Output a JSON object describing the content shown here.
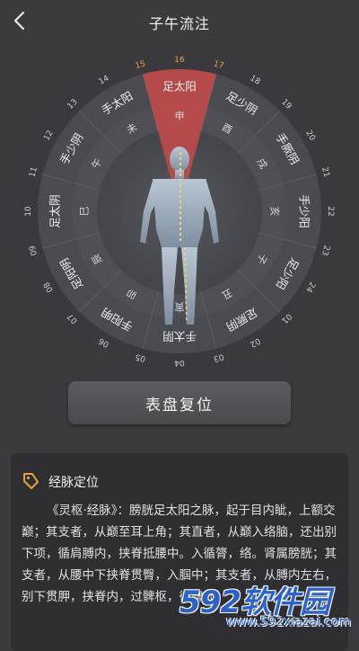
{
  "header": {
    "title": "子午流注"
  },
  "dial": {
    "hours": [
      "15",
      "16",
      "17",
      "18",
      "19",
      "20",
      "21",
      "22",
      "23",
      "24",
      "01",
      "02",
      "03",
      "04",
      "05",
      "06",
      "07",
      "08",
      "09",
      "10",
      "11",
      "12",
      "13",
      "14"
    ],
    "highlight_hour": "16",
    "meridians": [
      "足太阳",
      "足少阴",
      "手厥阴",
      "手少阳",
      "足少阳",
      "足厥阴",
      "手太阴",
      "手阳明",
      "足阳明",
      "足太阴",
      "手少阴",
      "手太阳"
    ],
    "branches": [
      "申",
      "酉",
      "戌",
      "亥",
      "子",
      "丑",
      "寅",
      "卯",
      "辰",
      "巳",
      "午",
      "未"
    ],
    "accent_color": "#c84a4a",
    "hour_color_active": "#e8a23a"
  },
  "reset_button": {
    "label": "表盘复位"
  },
  "panel": {
    "title": "经脉定位",
    "text": "《灵枢·经脉》：膀胱足太阳之脉，起于目内眦，上额交巅；其支者，从巅至耳上角；其直者，从巅入络脑，还出别下项，循肩膊内，挟脊抵腰中。入循膂，络。肾属膀胱；其支者，从腰中下挟脊贯臀，入腘中；其支者，从膊内左右，别下贯胛，挟脊内，过髀枢，循髀外"
  },
  "watermark": {
    "brand": "592软件园",
    "url": "www.592xiazai.com"
  }
}
